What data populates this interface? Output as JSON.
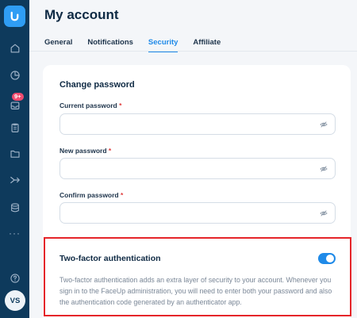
{
  "page": {
    "title": "My account"
  },
  "tabs": [
    {
      "label": "General"
    },
    {
      "label": "Notifications"
    },
    {
      "label": "Security"
    },
    {
      "label": "Affiliate"
    }
  ],
  "active_tab": "Security",
  "sidebar": {
    "items": [
      {
        "icon": "home-icon"
      },
      {
        "icon": "pie-chart-icon"
      },
      {
        "icon": "inbox-icon",
        "badge": "9+"
      },
      {
        "icon": "clipboard-icon"
      },
      {
        "icon": "folder-icon"
      },
      {
        "icon": "routing-icon"
      },
      {
        "icon": "database-icon"
      },
      {
        "icon": "more-icon",
        "label": "···"
      },
      {
        "icon": "help-icon"
      }
    ],
    "avatar": "VS"
  },
  "change_password": {
    "title": "Change password",
    "fields": [
      {
        "label": "Current password",
        "required": "*",
        "value": ""
      },
      {
        "label": "New password",
        "required": "*",
        "value": ""
      },
      {
        "label": "Confirm password",
        "required": "*",
        "value": ""
      }
    ]
  },
  "two_factor": {
    "title": "Two-factor authentication",
    "enabled": true,
    "description": "Two-factor authentication adds an extra layer of security to your account. Whenever you sign in to the FaceUp administration, you will need to enter both your password and also the authentication code generated by an authenticator app."
  },
  "colors": {
    "accent": "#1f8ae8",
    "sidebar": "#0e3a5c",
    "highlight": "#e5252a",
    "badge": "#ef4b6f"
  }
}
